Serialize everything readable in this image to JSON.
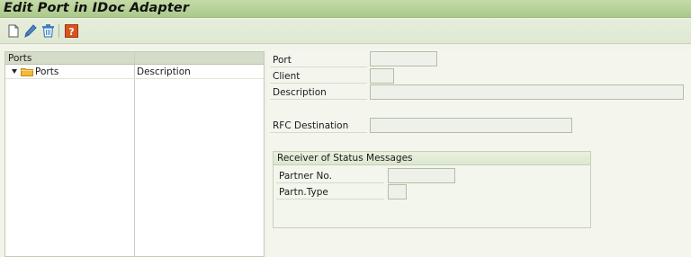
{
  "window": {
    "title": "Edit Port in IDoc Adapter"
  },
  "toolbar": {
    "icons": [
      "new-document-icon",
      "pencil-edit-icon",
      "trash-delete-icon",
      "help-question-icon"
    ]
  },
  "tree": {
    "column_header": "Ports",
    "nodes": [
      {
        "label": "Ports",
        "description": "Description"
      }
    ]
  },
  "form": {
    "port_label": "Port",
    "port_value": "",
    "client_label": "Client",
    "client_value": "",
    "description_label": "Description",
    "description_value": "",
    "rfc_label": "RFC Destination",
    "rfc_value": ""
  },
  "status_group": {
    "title": "Receiver of Status Messages",
    "partner_no_label": "Partner No.",
    "partner_no_value": "",
    "partner_type_label": "Partn.Type",
    "partner_type_value": ""
  },
  "colors": {
    "title_bar": "#b8d39a",
    "toolbar": "#e2ebd6",
    "background": "#f2f4ea",
    "help_icon": "#d9531e"
  }
}
